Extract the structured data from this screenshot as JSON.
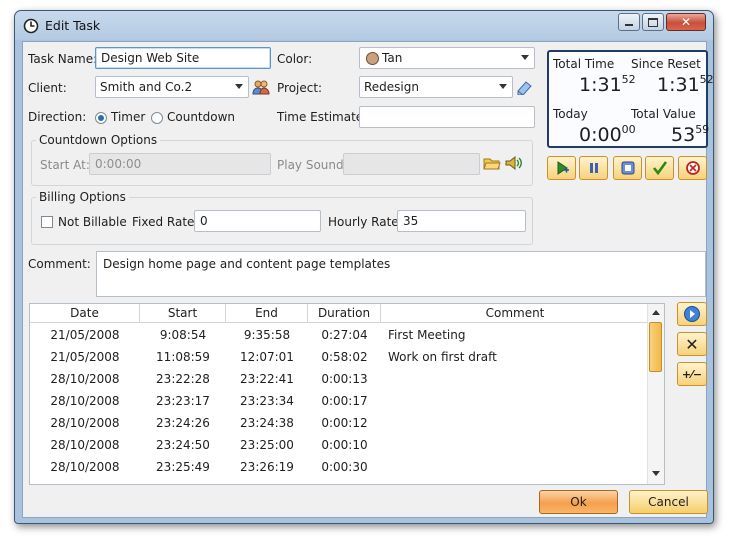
{
  "window": {
    "title": "Edit Task",
    "close_glyph": "✕"
  },
  "form": {
    "task_name_label": "Task Name:",
    "task_name_value": "Design Web Site",
    "color_label": "Color:",
    "color_value": "Tan",
    "color_swatch": "#c8a27c",
    "client_label": "Client:",
    "client_value": "Smith and Co.2",
    "project_label": "Project:",
    "project_value": "Redesign",
    "direction_label": "Direction:",
    "direction_options": [
      "Timer",
      "Countdown"
    ],
    "direction_selected": "Timer",
    "time_estimate_label": "Time Estimate:",
    "time_estimate_value": ""
  },
  "countdown": {
    "group_title": "Countdown Options",
    "start_at_label": "Start At:",
    "start_at_value": "0:00:00",
    "play_sound_label": "Play Sound:",
    "play_sound_value": ""
  },
  "billing": {
    "group_title": "Billing Options",
    "not_billable_label": "Not Billable",
    "not_billable_checked": false,
    "fixed_rate_label": "Fixed Rate:",
    "fixed_rate_value": "0",
    "hourly_rate_label": "Hourly Rate:",
    "hourly_rate_value": "35"
  },
  "stats": {
    "total_time_label": "Total Time",
    "total_time_main": "1:31",
    "total_time_sup": "52",
    "since_reset_label": "Since Reset",
    "since_reset_main": "1:31",
    "since_reset_sup": "52",
    "today_label": "Today",
    "today_main": "0:00",
    "today_sup": "00",
    "total_value_label": "Total Value",
    "total_value_main": "53",
    "total_value_sup": "59"
  },
  "comment": {
    "label": "Comment:",
    "value": "Design home page and content page templates"
  },
  "log": {
    "columns": [
      "Date",
      "Start",
      "End",
      "Duration",
      "Comment"
    ],
    "rows": [
      {
        "date": "21/05/2008",
        "start": "9:08:54",
        "end": "9:35:58",
        "duration": "0:27:04",
        "comment": "First Meeting"
      },
      {
        "date": "21/05/2008",
        "start": "11:08:59",
        "end": "12:07:01",
        "duration": "0:58:02",
        "comment": "Work on first draft"
      },
      {
        "date": "28/10/2008",
        "start": "23:22:28",
        "end": "23:22:41",
        "duration": "0:00:13",
        "comment": ""
      },
      {
        "date": "28/10/2008",
        "start": "23:23:17",
        "end": "23:23:34",
        "duration": "0:00:17",
        "comment": ""
      },
      {
        "date": "28/10/2008",
        "start": "23:24:26",
        "end": "23:24:38",
        "duration": "0:00:12",
        "comment": ""
      },
      {
        "date": "28/10/2008",
        "start": "23:24:50",
        "end": "23:25:00",
        "duration": "0:00:10",
        "comment": ""
      },
      {
        "date": "28/10/2008",
        "start": "23:25:49",
        "end": "23:26:19",
        "duration": "0:00:30",
        "comment": ""
      }
    ]
  },
  "side_buttons": {
    "add_icon": "add-entry-icon",
    "remove_glyph": "✕",
    "adjust_glyph": "+⁄−"
  },
  "actions": {
    "ok_label": "Ok",
    "cancel_label": "Cancel"
  }
}
